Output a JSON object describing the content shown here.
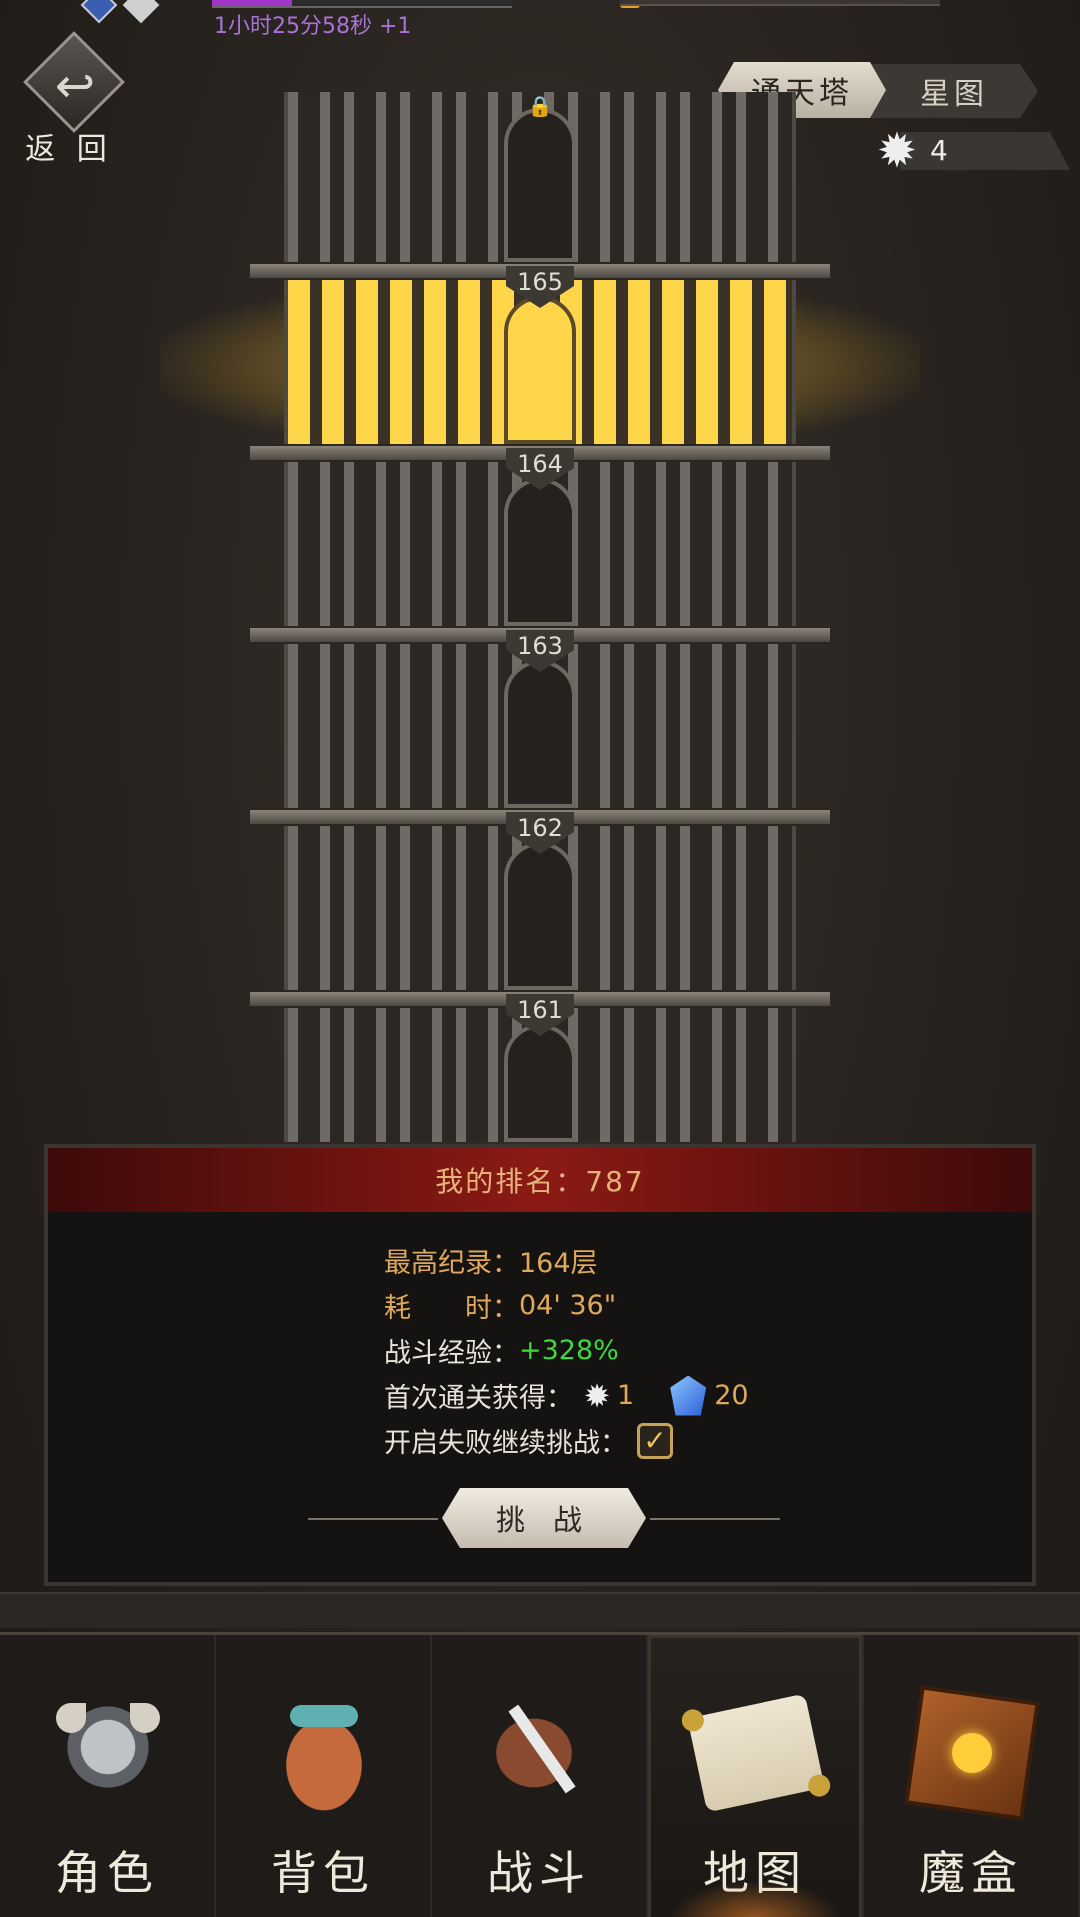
{
  "status_bar": {
    "timer_text": "1小时25分58秒 +1"
  },
  "back_button": {
    "label": "返 回"
  },
  "tabs": [
    {
      "label": "通天塔",
      "active": true
    },
    {
      "label": "星图",
      "active": false
    }
  ],
  "star_count": {
    "value": "4"
  },
  "tower": {
    "floors": [
      "165",
      "164",
      "163",
      "162",
      "161"
    ],
    "current_floor": "165"
  },
  "panel": {
    "rank_title": "我的排名：787",
    "best_record_label": "最高纪录：",
    "best_record_value": "164层",
    "time_label": "耗　　时：",
    "time_value": "04' 36\"",
    "exp_label": "战斗经验：",
    "exp_value": "+328%",
    "first_clear_label": "首次通关获得：",
    "first_clear_star": "1",
    "first_clear_gem": "20",
    "continue_label": "开启失败继续挑战：",
    "continue_checked": true,
    "challenge_button": "挑 战"
  },
  "nav": [
    {
      "label": "角色",
      "icon": "helmet-icon"
    },
    {
      "label": "背包",
      "icon": "backpack-icon"
    },
    {
      "label": "战斗",
      "icon": "sword-shield-icon"
    },
    {
      "label": "地图",
      "icon": "scroll-map-icon",
      "active": true
    },
    {
      "label": "魔盒",
      "icon": "magic-box-icon"
    }
  ],
  "colors": {
    "accent_gold": "#e0a85a",
    "highlight_window": "#ffd54a",
    "exp_green": "#3cd83c",
    "header_red": "#8c1a14",
    "timer_purple": "#a873d8"
  }
}
